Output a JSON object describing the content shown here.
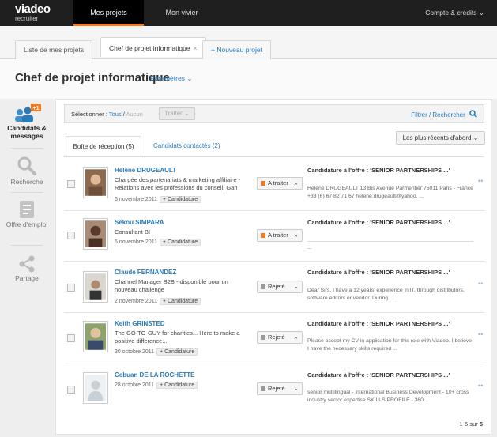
{
  "brand": {
    "name": "viadeo",
    "sub": "recruiter"
  },
  "topnav": {
    "tabs": [
      "Mes projets",
      "Mon vivier"
    ],
    "account": "Compte & crédits"
  },
  "project_tabs": {
    "list": "Liste de mes projets",
    "current": "Chef de projet informatique",
    "new": "Nouveau projet"
  },
  "header": {
    "title": "Chef de projet informatique",
    "params": "Paramètres"
  },
  "sidebar": {
    "badge": "+1",
    "items": [
      "Candidats & messages",
      "Recherche",
      "Offre d'emploi",
      "Partage"
    ]
  },
  "toolbar": {
    "select_label": "Sélectionner :",
    "all": "Tous",
    "none": "Aucun",
    "process": "Traiter",
    "filter": "Filtrer / Rechercher"
  },
  "inbox": {
    "tab_inbox": "Boîte de réception (5)",
    "tab_contacted": "Candidats contactés (2)",
    "sort": "Les plus récents d'abord"
  },
  "colors": {
    "a_traiter": "#f07a1f",
    "rejete": "#999999",
    "accent": "#2a7ab8"
  },
  "candidates": [
    {
      "name": "Hélène DRUGEAULT",
      "desc": "Chargée des partenariats & marketing affiliaire - Relations avec les professions du conseil, Gan",
      "date": "6 novembre 2011",
      "tag": "+ Candidature",
      "status": "A traiter",
      "subject": "Candidature à l'offre : 'SENIOR PARTNERSHIPS ...'",
      "excerpt": "Hélène DRUGEAULT 13 Bis Avenue Parmentier 75011 Paris - France +33 (6) 67 82 71 67 helene.drugeault@yahoo. ..."
    },
    {
      "name": "Sékou SIMPARA",
      "desc": "Consultant BI",
      "date": "5 novembre 2011",
      "tag": "+ Candidature",
      "status": "A traiter",
      "subject": "Candidature à l'offre : 'SENIOR PARTNERSHIPS ...'",
      "excerpt": "..."
    },
    {
      "name": "Claude FERNANDEZ",
      "desc": "Channel Manager B2B - disponible pour un nouveau challenge",
      "date": "2 novembre 2011",
      "tag": "+ Candidature",
      "status": "Rejeté",
      "subject": "Candidature à l'offre : 'SENIOR PARTNERSHIPS ...'",
      "excerpt": "Dear Sirs, I have a 12 years' experience in IT, through distributors, software editors or vendor. During ..."
    },
    {
      "name": "Keith GRINSTED",
      "desc": "The GO-TO-GUY for charities... Here to make a positive difference...",
      "date": "30 octobre 2011",
      "tag": "+ Candidature",
      "status": "Rejeté",
      "subject": "Candidature à l'offre : 'SENIOR PARTNERSHIPS ...'",
      "excerpt": "Please accept my CV in application for this role with Viadeo. I believe I have the necessary skills required ..."
    },
    {
      "name": "Cebuan DE LA ROCHETTE",
      "desc": "",
      "date": "28 octobre 2011",
      "tag": "+ Candidature",
      "status": "Rejeté",
      "subject": "Candidature à l'offre : 'SENIOR PARTNERSHIPS ...'",
      "excerpt": "senior multilingual - international Business Development - 10+ cross industry sector expertise SKILLS PROFILE - 360 ..."
    }
  ],
  "pager": {
    "range": "1-5",
    "of": "sur",
    "total": "5"
  }
}
